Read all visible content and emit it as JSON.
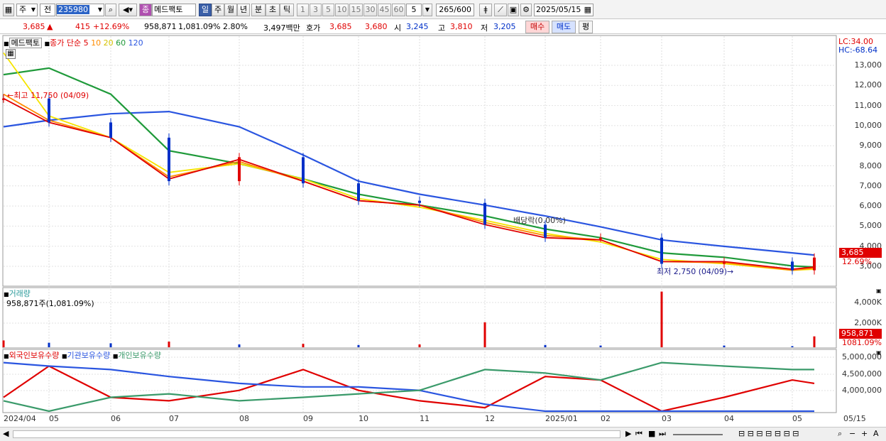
{
  "toolbar": {
    "market": "주",
    "market2": "전",
    "code": "235980",
    "name_tag": "종",
    "name": "메드팩토",
    "periods": [
      "일",
      "주",
      "월",
      "년",
      "분",
      "초",
      "틱"
    ],
    "minutes": [
      "1",
      "3",
      "5",
      "10",
      "15",
      "30",
      "45",
      "60"
    ],
    "interval_value": "5",
    "count": "265",
    "count_max": "/600",
    "date": "2025/05/15"
  },
  "quote": {
    "price": "3,685",
    "change": "415",
    "change_pct": "+12.69%",
    "volume": "958,871",
    "volume_pct": "1,081.09%",
    "turnover": "2.80%",
    "amount": "3,497백만",
    "ask_label": "호가",
    "ask": "3,685",
    "bid": "3,680",
    "open_label": "시",
    "open": "3,245",
    "high_label": "고",
    "high": "3,810",
    "low_label": "저",
    "low": "3,205",
    "buy": "매수",
    "sell": "매도",
    "eval": "평"
  },
  "price_panel": {
    "name": "메드팩토",
    "ma_title": "종가 단순",
    "ma_periods": [
      "5",
      "10",
      "20",
      "60",
      "120"
    ],
    "lc": "LC:34.00",
    "hc": "HC:-68.64",
    "high_note": "최고 11,750 (04/09)",
    "low_note": "최저 2,750 (04/09)",
    "dividend_note": "배당락(0.00%)",
    "axis": [
      "13,000",
      "12,000",
      "11,000",
      "10,000",
      "9,000",
      "8,000",
      "7,000",
      "6,000",
      "5,000",
      "4,000",
      "3,000"
    ],
    "last_price": "3,685",
    "last_pct": "12.69%"
  },
  "volume_panel": {
    "title": "거래량",
    "value": "958,871주(1,081.09%)",
    "axis": [
      "4,000K",
      "2,000K"
    ],
    "last_volume": "958,871",
    "last_pct": "1081.09%"
  },
  "holding_panel": {
    "title_foreign": "외국인보유수량",
    "title_inst": "기관보유수량",
    "title_indiv": "개인보유수량",
    "axis": [
      "5,000,000",
      "4,500,000",
      "4,000,000"
    ]
  },
  "x_axis": [
    "2024/04",
    "05",
    "06",
    "07",
    "08",
    "09",
    "10",
    "11",
    "12",
    "2025/01",
    "02",
    "03",
    "04",
    "05",
    "05/15"
  ],
  "colors": {
    "up": "#e00000",
    "down": "#0030c8",
    "ma5": "#e00000",
    "ma10": "#ff8c00",
    "ma20": "#f5e400",
    "ma60": "#1f9a3a",
    "ma120": "#2a55e0",
    "foreign": "#e00000",
    "institution": "#2a55e0",
    "individual": "#3a9a6a"
  },
  "chart_data": [
    {
      "type": "candlestick",
      "title": "메드팩토",
      "ylim": [
        2500,
        13800
      ],
      "x": [
        "2024/04",
        "05",
        "06",
        "07",
        "08",
        "09",
        "10",
        "11",
        "12",
        "2025/01",
        "02",
        "03",
        "04",
        "05",
        "05/15"
      ],
      "series": [
        {
          "name": "5",
          "values": [
            11000,
            9900,
            9200,
            7300,
            8200,
            7200,
            6300,
            6100,
            5200,
            4600,
            4500,
            3500,
            3500,
            3150,
            3250
          ]
        },
        {
          "name": "10",
          "values": [
            11200,
            10000,
            9200,
            7400,
            8100,
            7200,
            6300,
            6100,
            5300,
            4700,
            4500,
            3500,
            3450,
            3100,
            3200
          ]
        },
        {
          "name": "20",
          "values": [
            13100,
            10200,
            9200,
            7600,
            8000,
            7300,
            6400,
            6000,
            5400,
            4800,
            4400,
            3600,
            3400,
            3100,
            3150
          ]
        },
        {
          "name": "60",
          "values": [
            12100,
            12400,
            11200,
            8600,
            8000,
            7300,
            6600,
            6100,
            5600,
            5000,
            4600,
            3900,
            3700,
            3300,
            3250
          ]
        },
        {
          "name": "120",
          "values": [
            9700,
            10000,
            10300,
            10400,
            9700,
            8400,
            7200,
            6600,
            6100,
            5600,
            5100,
            4500,
            4200,
            3900,
            3800
          ]
        }
      ],
      "close": [
        11000,
        9900,
        9200,
        7200,
        8300,
        7100,
        6300,
        6200,
        5200,
        4600,
        4600,
        3400,
        3500,
        3100,
        3685
      ]
    },
    {
      "type": "bar",
      "title": "거래량",
      "ylim": [
        0,
        5000000
      ],
      "categories": [
        "2024/04",
        "05",
        "06",
        "07",
        "08",
        "09",
        "10",
        "11",
        "12",
        "2025/01",
        "02",
        "03",
        "04",
        "05",
        "05/15"
      ],
      "values": [
        600000,
        400000,
        350000,
        500000,
        250000,
        300000,
        200000,
        250000,
        2200000,
        200000,
        150000,
        4900000,
        150000,
        100000,
        958871
      ]
    },
    {
      "type": "line",
      "ylim": [
        3600000,
        5300000
      ],
      "x": [
        "2024/04",
        "05",
        "06",
        "07",
        "08",
        "09",
        "10",
        "11",
        "12",
        "2025/01",
        "02",
        "03",
        "04",
        "05",
        "05/15"
      ],
      "series": [
        {
          "name": "외국인보유수량",
          "values": [
            4000000,
            4900000,
            4000000,
            3900000,
            4200000,
            4800000,
            4200000,
            3900000,
            3700000,
            4600000,
            4500000,
            3600000,
            4000000,
            4500000,
            4400000
          ]
        },
        {
          "name": "기관보유수량",
          "values": [
            5000000,
            4900000,
            4800000,
            4600000,
            4400000,
            4300000,
            4300000,
            4200000,
            3800000,
            3600000,
            3600000,
            3600000,
            3600000,
            3600000,
            3600000
          ]
        },
        {
          "name": "개인보유수량",
          "values": [
            3900000,
            3600000,
            4000000,
            4100000,
            3900000,
            4000000,
            4100000,
            4200000,
            4800000,
            4700000,
            4500000,
            5000000,
            4900000,
            4800000,
            4800000
          ]
        }
      ]
    }
  ]
}
